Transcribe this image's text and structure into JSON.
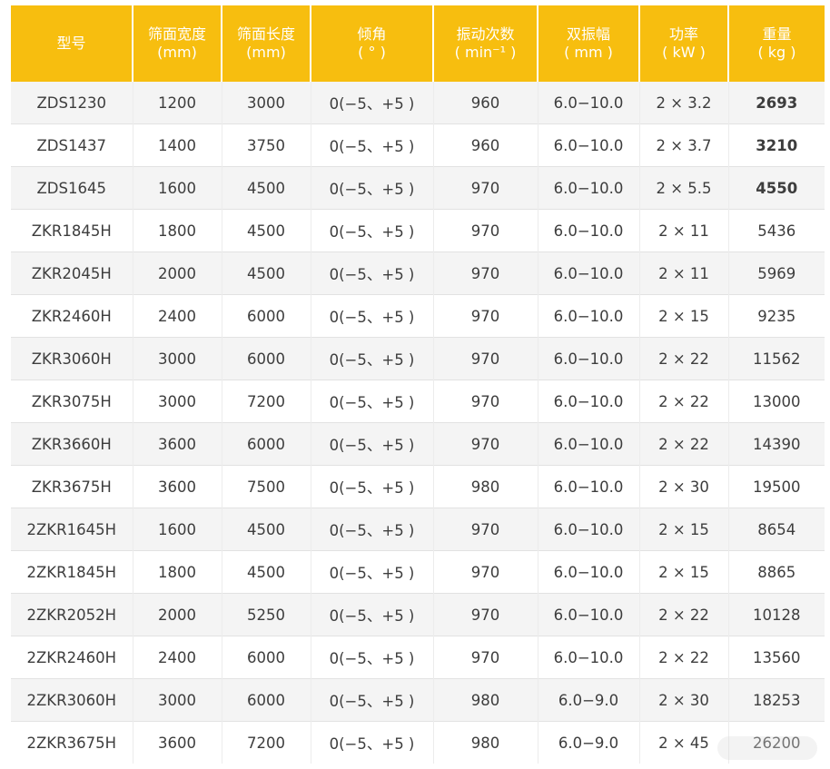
{
  "headers": [
    {
      "l1": "型号",
      "l2": ""
    },
    {
      "l1": "筛面宽度",
      "l2": "(mm)"
    },
    {
      "l1": "筛面长度",
      "l2": "(mm)"
    },
    {
      "l1": "倾角",
      "l2": "( ° )"
    },
    {
      "l1": "振动次数",
      "l2": "( min⁻¹ )"
    },
    {
      "l1": "双振幅",
      "l2": "( mm )"
    },
    {
      "l1": "功率",
      "l2": "( kW )"
    },
    {
      "l1": "重量",
      "l2": "( kg )"
    }
  ],
  "rows": [
    [
      "ZDS1230",
      "1200",
      "3000",
      "0(−5、+5 )",
      "960",
      "6.0−10.0",
      "2 × 3.2",
      "2693"
    ],
    [
      "ZDS1437",
      "1400",
      "3750",
      "0(−5、+5 )",
      "960",
      "6.0−10.0",
      "2 × 3.7",
      "3210"
    ],
    [
      "ZDS1645",
      "1600",
      "4500",
      "0(−5、+5 )",
      "970",
      "6.0−10.0",
      "2 × 5.5",
      "4550"
    ],
    [
      "ZKR1845H",
      "1800",
      "4500",
      "0(−5、+5 )",
      "970",
      "6.0−10.0",
      "2 × 11",
      "5436"
    ],
    [
      "ZKR2045H",
      "2000",
      "4500",
      "0(−5、+5 )",
      "970",
      "6.0−10.0",
      "2 × 11",
      "5969"
    ],
    [
      "ZKR2460H",
      "2400",
      "6000",
      "0(−5、+5 )",
      "970",
      "6.0−10.0",
      "2 × 15",
      "9235"
    ],
    [
      "ZKR3060H",
      "3000",
      "6000",
      "0(−5、+5 )",
      "970",
      "6.0−10.0",
      "2 × 22",
      "11562"
    ],
    [
      "ZKR3075H",
      "3000",
      "7200",
      "0(−5、+5 )",
      "970",
      "6.0−10.0",
      "2 × 22",
      "13000"
    ],
    [
      "ZKR3660H",
      "3600",
      "6000",
      "0(−5、+5 )",
      "970",
      "6.0−10.0",
      "2 × 22",
      "14390"
    ],
    [
      "ZKR3675H",
      "3600",
      "7500",
      "0(−5、+5 )",
      "980",
      "6.0−10.0",
      "2 × 30",
      "19500"
    ],
    [
      "2ZKR1645H",
      "1600",
      "4500",
      "0(−5、+5 )",
      "970",
      "6.0−10.0",
      "2 × 15",
      "8654"
    ],
    [
      "2ZKR1845H",
      "1800",
      "4500",
      "0(−5、+5 )",
      "970",
      "6.0−10.0",
      "2 × 15",
      "8865"
    ],
    [
      "2ZKR2052H",
      "2000",
      "5250",
      "0(−5、+5 )",
      "970",
      "6.0−10.0",
      "2 × 22",
      "10128"
    ],
    [
      "2ZKR2460H",
      "2400",
      "6000",
      "0(−5、+5 )",
      "970",
      "6.0−10.0",
      "2 × 22",
      "13560"
    ],
    [
      "2ZKR3060H",
      "3000",
      "6000",
      "0(−5、+5 )",
      "980",
      "6.0−9.0",
      "2 × 30",
      "18253"
    ],
    [
      "2ZKR3675H",
      "3600",
      "7200",
      "0(−5、+5 )",
      "980",
      "6.0−9.0",
      "2 × 45",
      "26200"
    ]
  ],
  "colors": {
    "header_bg": "#f7be0f",
    "header_text": "#ffffff",
    "row_odd": "#f4f4f4",
    "row_even": "#ffffff"
  }
}
